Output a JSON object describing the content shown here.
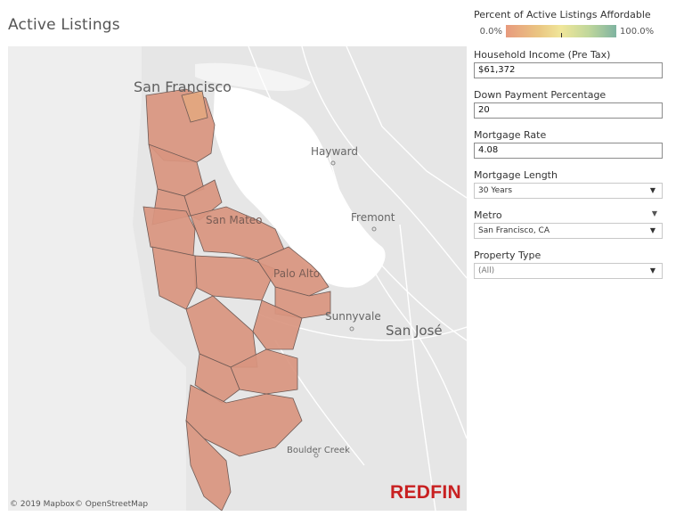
{
  "title": "Active Listings",
  "map": {
    "labels": {
      "san_francisco": "San Francisco",
      "hayward": "Hayward",
      "fremont": "Fremont",
      "san_mateo": "San Mateo",
      "palo_alto": "Palo Alto",
      "sunnyvale": "Sunnyvale",
      "san_jose": "San José",
      "boulder_creek": "Boulder Creek"
    },
    "attribution": "© 2019 Mapbox© OpenStreetMap",
    "brand": "REDFIN",
    "region_fill": "#d9957f",
    "region_stroke": "#6e5a55"
  },
  "legend": {
    "title": "Percent of Active Listings Affordable",
    "min_label": "0.0%",
    "max_label": "100.0%",
    "colors": [
      "#e89a7d",
      "#eac682",
      "#f0e69a",
      "#c0d79b",
      "#7fb3a1"
    ]
  },
  "filters": {
    "income": {
      "label": "Household Income (Pre Tax)",
      "value": "$61,372"
    },
    "down_payment": {
      "label": "Down Payment Percentage",
      "value": "20"
    },
    "mortgage_rate": {
      "label": "Mortgage Rate",
      "value": "4.08"
    },
    "mortgage_length": {
      "label": "Mortgage Length",
      "value": "30 Years"
    },
    "metro": {
      "label": "Metro",
      "value": "San Francisco, CA"
    },
    "property_type": {
      "label": "Property Type",
      "value": "(All)"
    }
  }
}
